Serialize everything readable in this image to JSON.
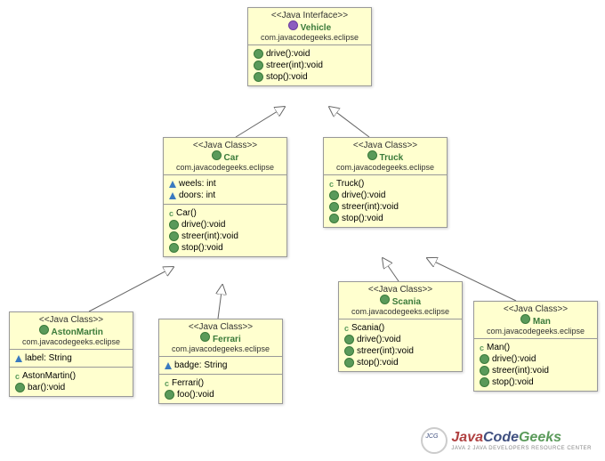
{
  "vehicle": {
    "stereo": "<<Java Interface>>",
    "name": "Vehicle",
    "pkg": "com.javacodegeeks.eclipse",
    "methods": [
      "drive():void",
      "streer(int):void",
      "stop():void"
    ]
  },
  "car": {
    "stereo": "<<Java Class>>",
    "name": "Car",
    "pkg": "com.javacodegeeks.eclipse",
    "fields": [
      "weels: int",
      "doors: int"
    ],
    "con": "Car()",
    "methods": [
      "drive():void",
      "streer(int):void",
      "stop():void"
    ]
  },
  "truck": {
    "stereo": "<<Java Class>>",
    "name": "Truck",
    "pkg": "com.javacodegeeks.eclipse",
    "con": "Truck()",
    "methods": [
      "drive():void",
      "streer(int):void",
      "stop():void"
    ]
  },
  "aston": {
    "stereo": "<<Java Class>>",
    "name": "AstonMartin",
    "pkg": "com.javacodegeeks.eclipse",
    "fields": [
      "label: String"
    ],
    "con": "AstonMartin()",
    "methods": [
      "bar():void"
    ]
  },
  "ferrari": {
    "stereo": "<<Java Class>>",
    "name": "Ferrari",
    "pkg": "com.javacodegeeks.eclipse",
    "fields": [
      "badge: String"
    ],
    "con": "Ferrari()",
    "methods": [
      "foo():void"
    ]
  },
  "scania": {
    "stereo": "<<Java Class>>",
    "name": "Scania",
    "pkg": "com.javacodegeeks.eclipse",
    "con": "Scania()",
    "methods": [
      "drive():void",
      "streer(int):void",
      "stop():void"
    ]
  },
  "man": {
    "stereo": "<<Java Class>>",
    "name": "Man",
    "pkg": "com.javacodegeeks.eclipse",
    "con": "Man()",
    "methods": [
      "drive():void",
      "streer(int):void",
      "stop():void"
    ]
  },
  "logo": {
    "j": "Java",
    "c": "Code",
    "g": "Geeks",
    "sub": "JAVA 2 JAVA DEVELOPERS RESOURCE CENTER"
  }
}
